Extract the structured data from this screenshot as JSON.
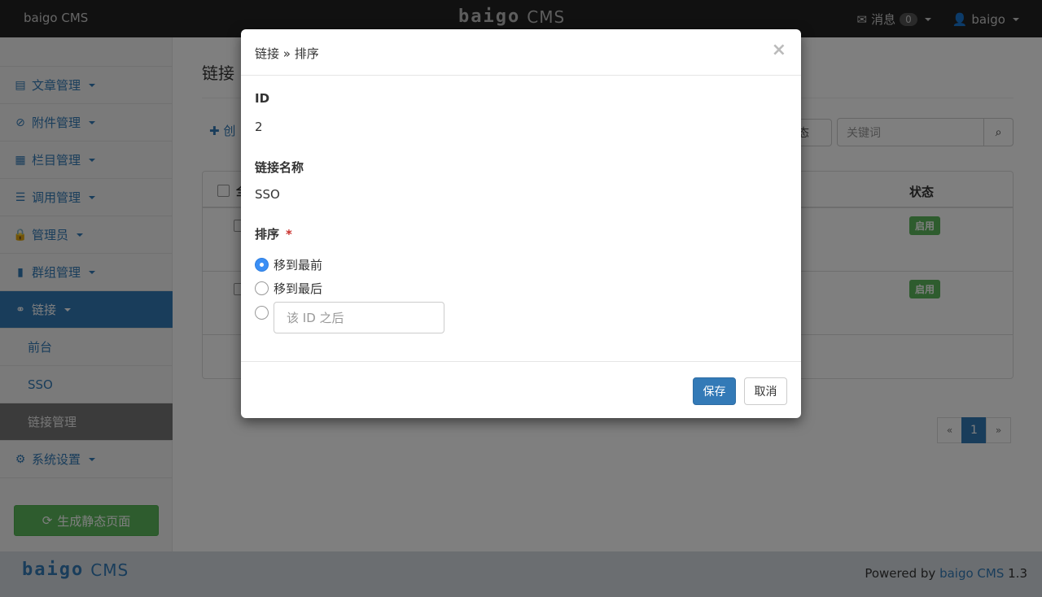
{
  "navbar": {
    "brand_text": "baigo CMS",
    "logo_mark": "baigo",
    "logo_cms": "CMS",
    "messages_label": "消息",
    "messages_count": "0",
    "user_label": "baigo"
  },
  "sidebar": {
    "items": [
      {
        "label": "文章管理",
        "icon": "file-icon"
      },
      {
        "label": "附件管理",
        "icon": "paperclip-icon"
      },
      {
        "label": "栏目管理",
        "icon": "grid-icon"
      },
      {
        "label": "调用管理",
        "icon": "list-icon"
      },
      {
        "label": "管理员",
        "icon": "lock-icon"
      },
      {
        "label": "群组管理",
        "icon": "bookmark-icon"
      },
      {
        "label": "链接",
        "icon": "link-icon"
      }
    ],
    "sub_items": [
      "前台",
      "SSO",
      "链接管理"
    ],
    "settings_label": "系统设置",
    "generate_button": "生成静态页面"
  },
  "main": {
    "heading": "链接",
    "create_label": "创",
    "status_select": "态",
    "search_placeholder": "关键词",
    "table_header_all": "全",
    "table_header_status": "状态",
    "rows": [
      {
        "status": "启用"
      },
      {
        "status": "启用"
      }
    ],
    "pagination": {
      "prev": "«",
      "current": "1",
      "next": "»"
    }
  },
  "modal": {
    "title": "链接 » 排序",
    "close": "×",
    "id_label": "ID",
    "id_value": "2",
    "name_label": "链接名称",
    "name_value": "SSO",
    "order_label": "排序",
    "required_mark": "*",
    "options": [
      "移到最前",
      "移到最后"
    ],
    "after_id_placeholder": "该 ID 之后",
    "save_button": "保存",
    "cancel_button": "取消"
  },
  "footer": {
    "logo_mark": "baigo",
    "logo_cms": "CMS",
    "powered_prefix": "Powered by",
    "powered_link": "baigo CMS",
    "version": "1.3"
  },
  "colors": {
    "primary": "#337ab7",
    "success": "#5cb85c",
    "navbar": "#222222",
    "footer": "#d7dde3"
  }
}
